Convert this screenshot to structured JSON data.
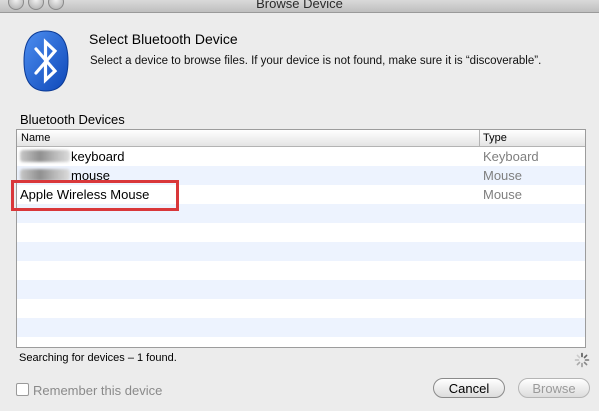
{
  "window": {
    "title": "Browse Device"
  },
  "header": {
    "heading": "Select Bluetooth Device",
    "subtext": "Select a device to browse files.  If your device is not found, make sure it is “discoverable”."
  },
  "devices_section": {
    "label": "Bluetooth Devices",
    "columns": [
      "Name",
      "Type"
    ],
    "rows": [
      {
        "name": "keyboard",
        "type": "Keyboard",
        "name_obscured": true
      },
      {
        "name": "mouse",
        "type": "Mouse",
        "name_obscured": true
      },
      {
        "name": "Apple Wireless Mouse",
        "type": "Mouse",
        "name_obscured": false
      }
    ],
    "highlight_color": "#d9373a"
  },
  "status": {
    "text": "Searching for devices – 1 found."
  },
  "footer": {
    "remember_label": "Remember this device",
    "remember_checked": false,
    "cancel_label": "Cancel",
    "browse_label": "Browse"
  },
  "icons": {
    "header_icon": "bluetooth-icon",
    "status_icon": "spinner-icon"
  },
  "colors": {
    "bluetooth_blue": "#1a5fd0",
    "row_stripe": "#edf3fe"
  }
}
